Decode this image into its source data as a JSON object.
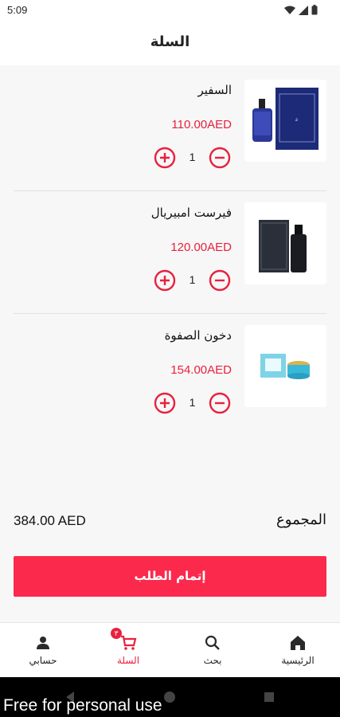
{
  "status_bar": {
    "time": "5:09"
  },
  "header": {
    "title": "السلة"
  },
  "cart": {
    "items": [
      {
        "name": "السفير",
        "price": "110.00AED",
        "quantity": "1",
        "image": "blue-perfume-bottle-with-box"
      },
      {
        "name": "فيرست امبيريال",
        "price": "120.00AED",
        "quantity": "1",
        "image": "dark-perfume-bottle-with-box"
      },
      {
        "name": "دخون الصفوة",
        "price": "154.00AED",
        "quantity": "1",
        "image": "turquoise-bakhoor-jar-with-box"
      }
    ]
  },
  "summary": {
    "total_label": "المجموع",
    "total_value": "384.00 AED"
  },
  "checkout": {
    "label": "إتمام الطلب"
  },
  "bottom_nav": {
    "home": {
      "label": "الرئيسية",
      "icon": "home-icon"
    },
    "search": {
      "label": "بحث",
      "icon": "search-icon"
    },
    "cart": {
      "label": "السلة",
      "icon": "cart-icon",
      "badge": "٣"
    },
    "account": {
      "label": "حسابي",
      "icon": "person-icon"
    }
  },
  "watermark": "Free for personal use",
  "colors": {
    "accent": "#fb2a4d",
    "price": "#e8213e",
    "background": "#f7f7f7"
  }
}
